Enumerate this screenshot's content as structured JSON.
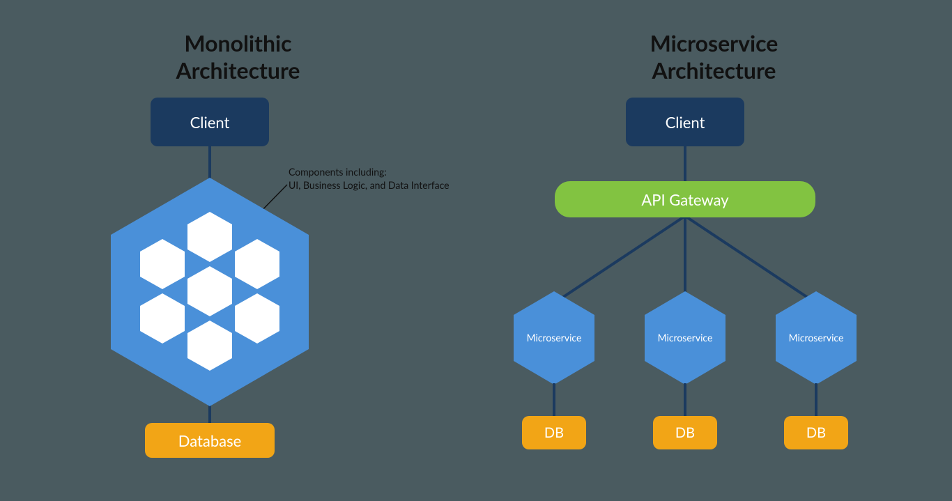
{
  "monolithic": {
    "title_line1": "Monolithic",
    "title_line2": "Architecture",
    "client_label": "Client",
    "database_label": "Database",
    "annotation_line1": "Components including:",
    "annotation_line2": "UI, Business Logic, and Data Interface"
  },
  "microservice": {
    "title_line1": "Microservice",
    "title_line2": "Architecture",
    "client_label": "Client",
    "gateway_label": "API Gateway",
    "services": [
      {
        "label": "Microservice",
        "db_label": "DB"
      },
      {
        "label": "Microservice",
        "db_label": "DB"
      },
      {
        "label": "Microservice",
        "db_label": "DB"
      }
    ]
  },
  "colors": {
    "background": "#4a5b60",
    "navy": "#1b3a5f",
    "blue": "#4a90d9",
    "green": "#82c341",
    "orange": "#f2a516",
    "white": "#ffffff"
  }
}
